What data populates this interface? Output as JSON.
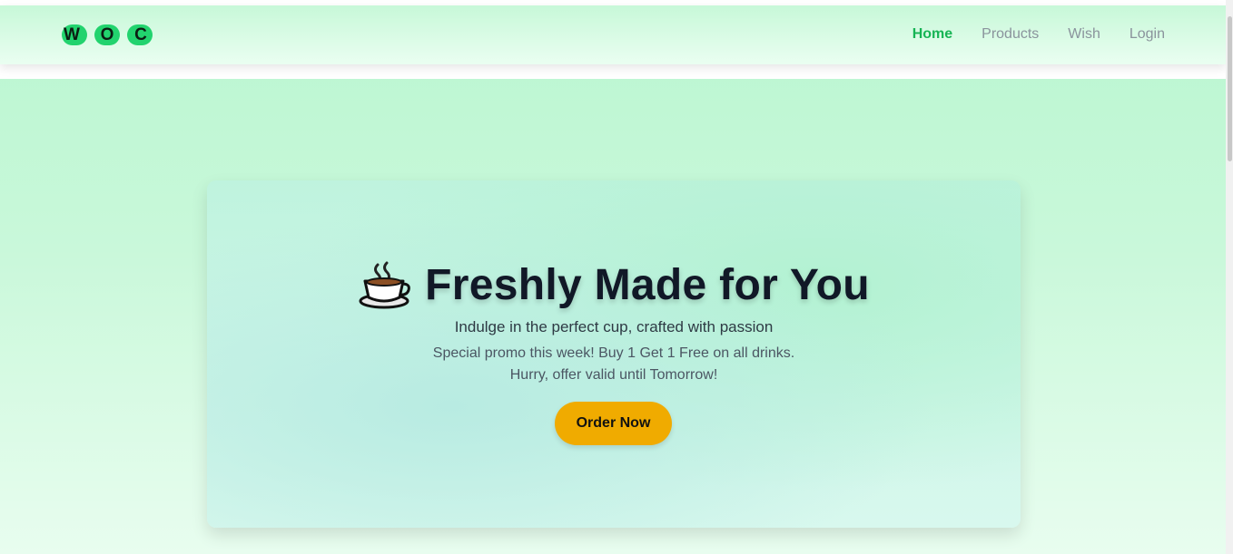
{
  "brand": {
    "letters": [
      "W",
      "O",
      "C"
    ],
    "accent_color": "#22d36e"
  },
  "nav": {
    "items": [
      {
        "label": "Home",
        "active": true
      },
      {
        "label": "Products",
        "active": false
      },
      {
        "label": "Wish",
        "active": false
      },
      {
        "label": "Login",
        "active": false
      }
    ],
    "active_color": "#16b454"
  },
  "hero": {
    "icon": "coffee-cup-icon",
    "title": "Freshly Made for You",
    "subtitle": "Indulge in the perfect cup, crafted with passion",
    "promo_line_1": "Special promo this week! Buy 1 Get 1 Free on all drinks.",
    "promo_line_2": "Hurry, offer valid until Tomorrow!",
    "cta_label": "Order Now",
    "cta_color": "#f0ab00"
  }
}
